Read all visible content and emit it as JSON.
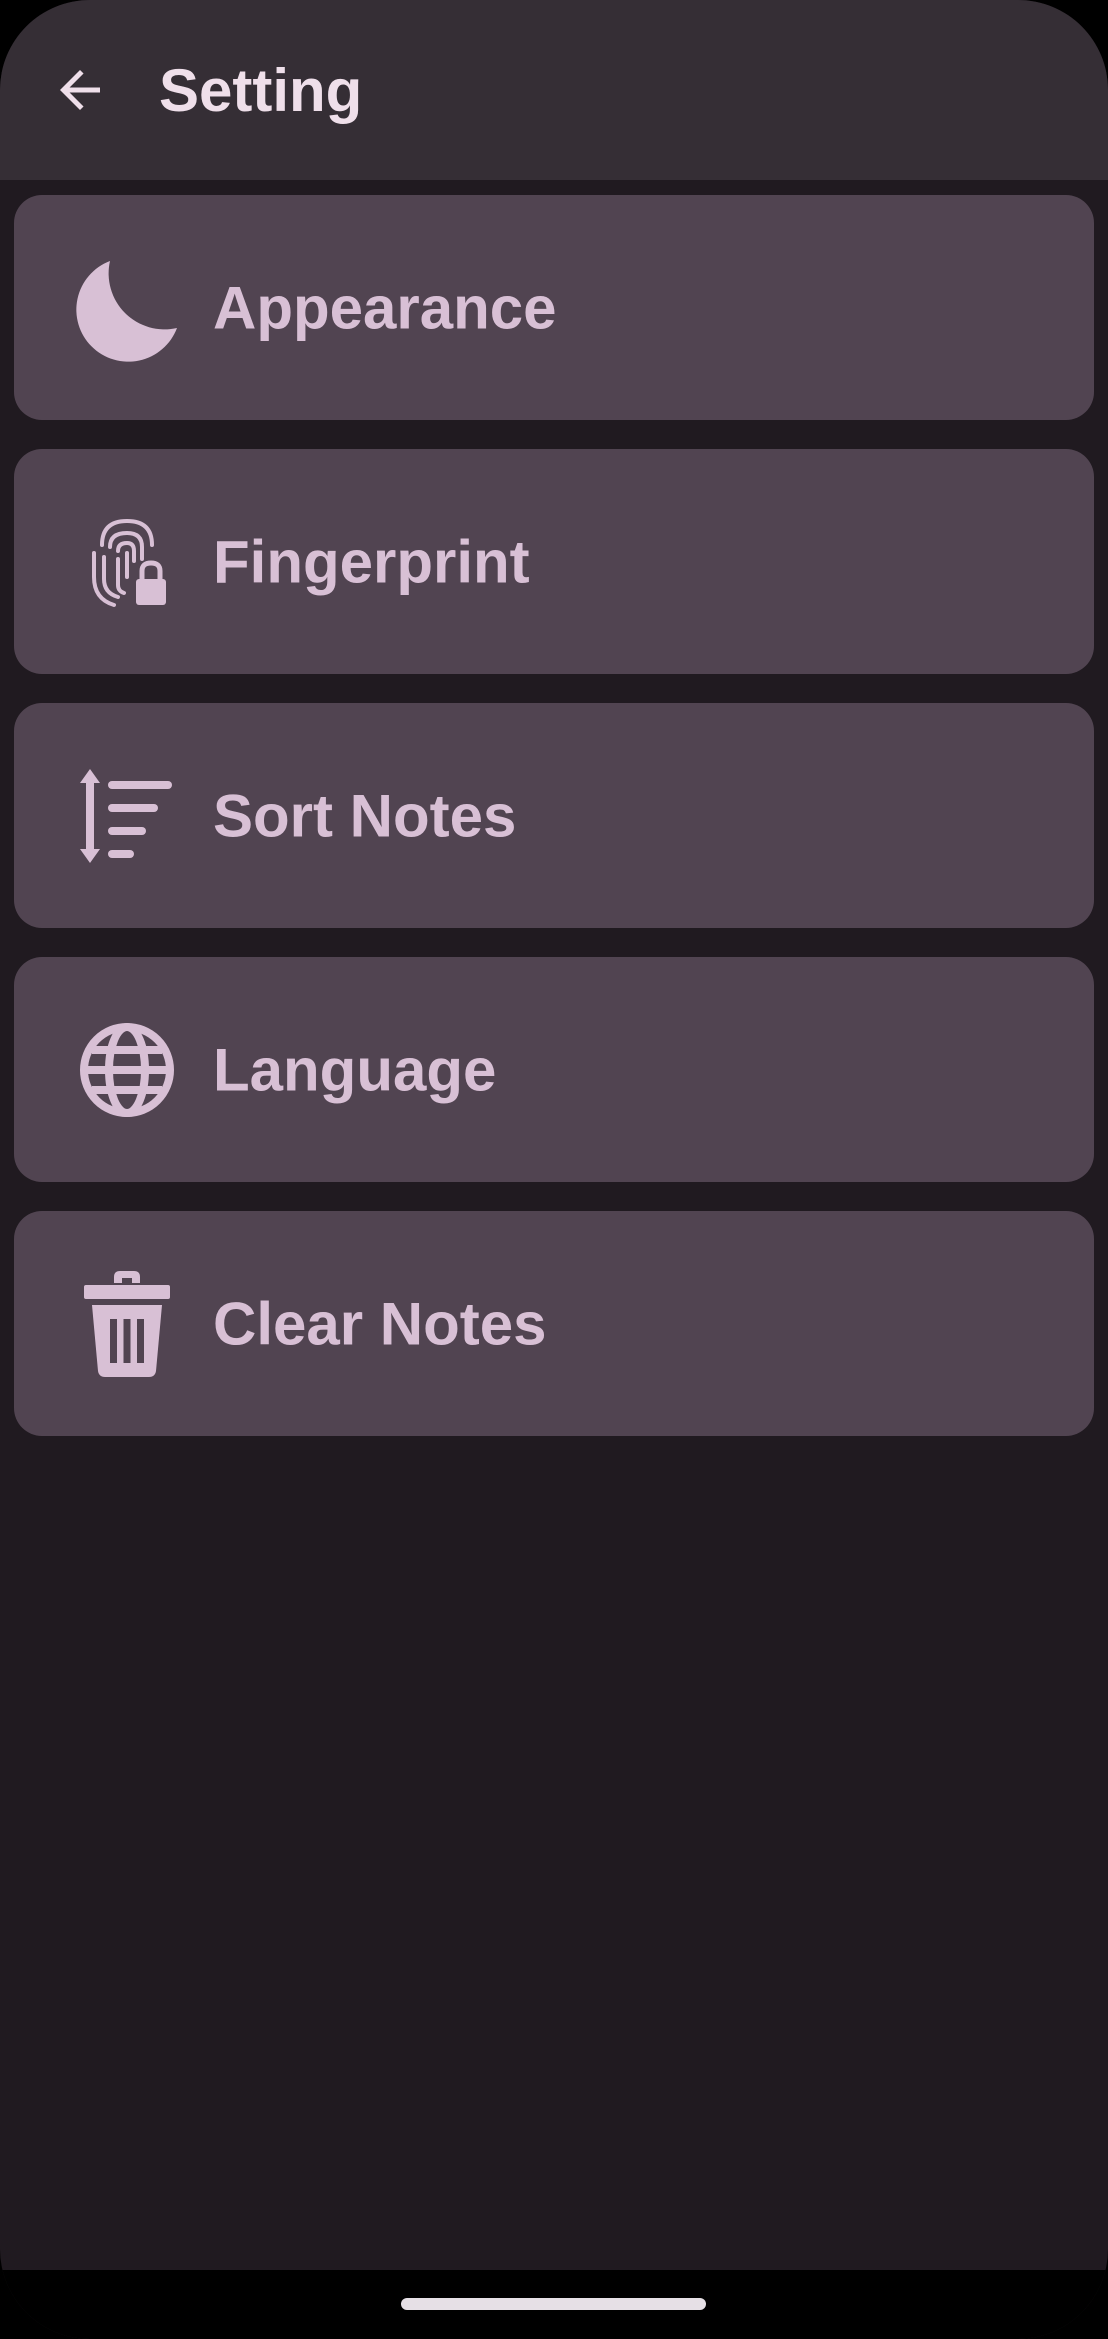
{
  "colors": {
    "background": "#201a20",
    "app_bar": "#352e35",
    "card": "#514451",
    "title_text": "#efdfea",
    "item_text": "#d8c0d5",
    "icon": "#d8c0d5"
  },
  "header": {
    "title": "Setting",
    "back_icon": "arrow-left-icon"
  },
  "settings": {
    "items": [
      {
        "label": "Appearance",
        "icon": "moon-icon"
      },
      {
        "label": "Fingerprint",
        "icon": "fingerprint-lock-icon"
      },
      {
        "label": "Sort Notes",
        "icon": "sort-icon"
      },
      {
        "label": "Language",
        "icon": "globe-icon"
      },
      {
        "label": "Clear Notes",
        "icon": "trash-icon"
      }
    ]
  }
}
